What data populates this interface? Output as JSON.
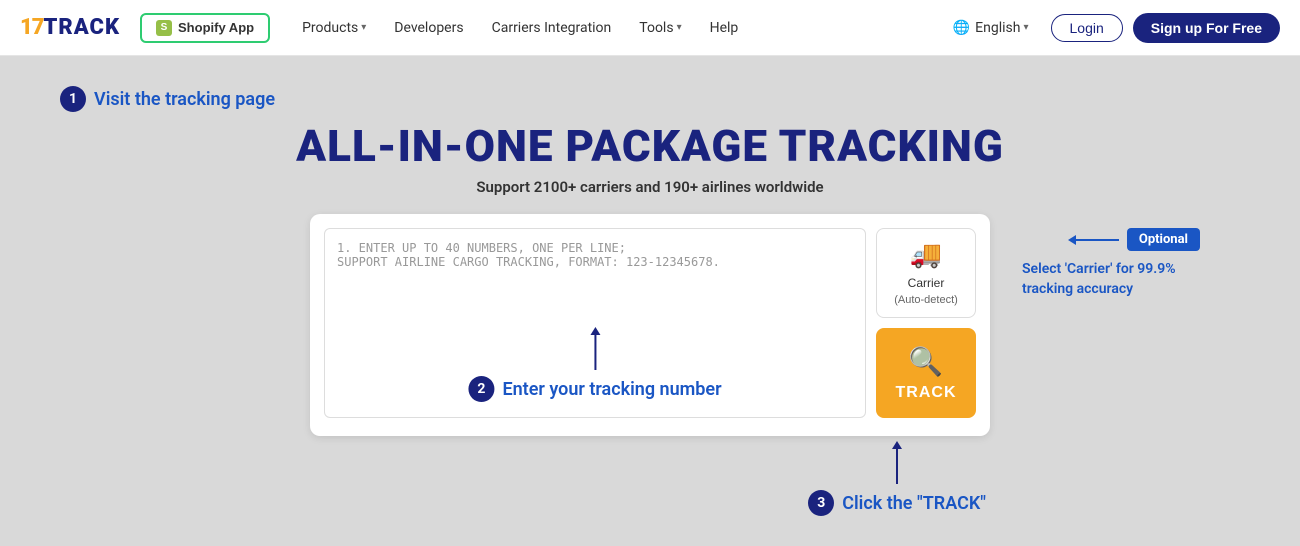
{
  "logo": {
    "part1": "17",
    "part2": "TRACK"
  },
  "nav": {
    "shopify_label": "Shopify App",
    "items": [
      {
        "label": "Products",
        "has_chevron": true
      },
      {
        "label": "Developers",
        "has_chevron": false
      },
      {
        "label": "Carriers Integration",
        "has_chevron": false
      },
      {
        "label": "Tools",
        "has_chevron": true
      },
      {
        "label": "Help",
        "has_chevron": false
      }
    ],
    "language": {
      "label": "English",
      "has_chevron": true
    },
    "login": "Login",
    "signup": "Sign up For Free"
  },
  "hero": {
    "step1_label": "Visit the tracking page",
    "title": "ALL-IN-ONE PACKAGE TRACKING",
    "subtitle": "Support 2100+ carriers and 190+ airlines worldwide"
  },
  "tracking": {
    "placeholder_line1": "1. ENTER UP TO 40 NUMBERS, ONE PER LINE;",
    "placeholder_line2": "SUPPORT AIRLINE CARGO TRACKING, FORMAT: 123-12345678.",
    "carrier_label": "Carrier",
    "carrier_sub": "(Auto-detect)",
    "track_label": "TRACK"
  },
  "annotations": {
    "step2_label": "Enter your tracking number",
    "optional_badge": "Optional",
    "optional_desc": "Select 'Carrier' for 99.9% tracking accuracy",
    "step3_label": "Click the \"TRACK\""
  }
}
